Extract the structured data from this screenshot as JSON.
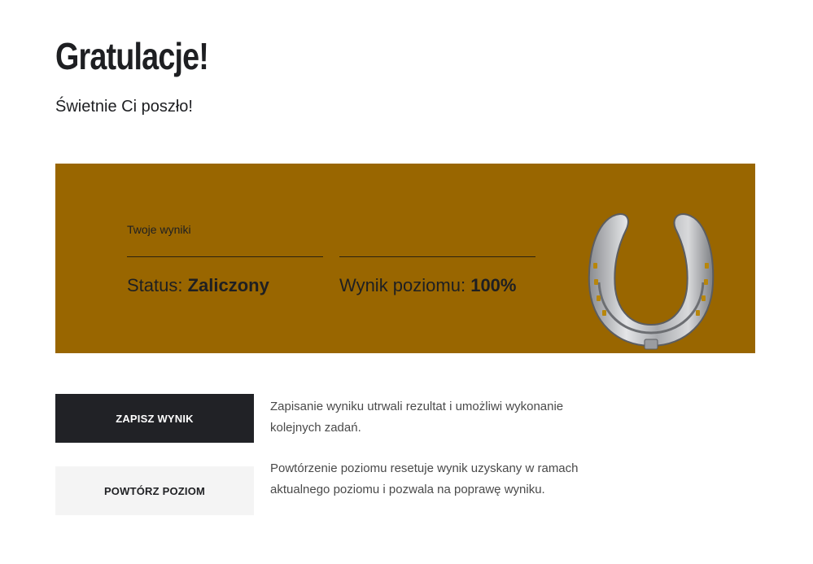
{
  "header": {
    "title": "Gratulacje!",
    "subtitle": "Świetnie Ci poszło!"
  },
  "results": {
    "section_label": "Twoje wyniki",
    "status_label": "Status:",
    "status_value": "Zaliczony",
    "score_label": "Wynik poziomu:",
    "score_value": "100%",
    "background_color": "#996600",
    "icon": "horseshoe-icon"
  },
  "actions": {
    "save_label": "ZAPISZ WYNIK",
    "save_description": "Zapisanie wyniku utrwali rezultat i umożliwi wykonanie kolejnych zadań.",
    "retry_label": "POWTÓRZ POZIOM",
    "retry_description": "Powtórzenie poziomu resetuje wynik uzyskany w ramach aktualnego poziomu i pozwala na poprawę wyniku."
  }
}
